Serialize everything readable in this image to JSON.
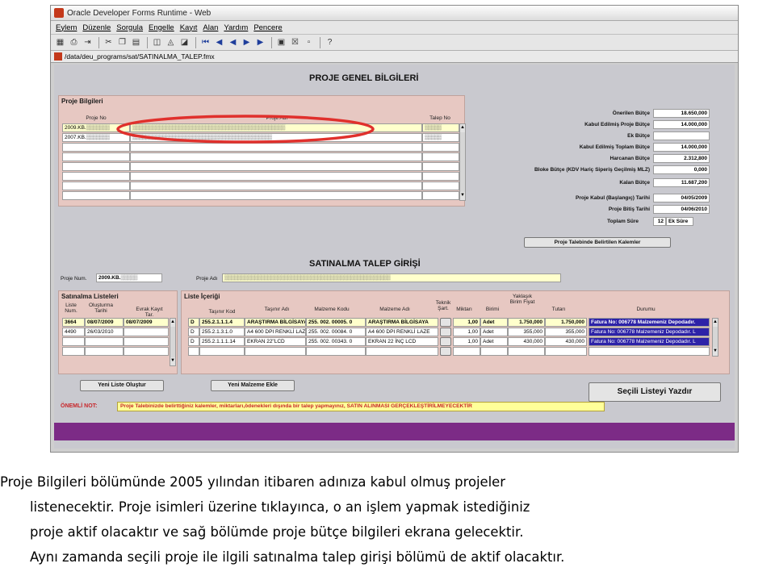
{
  "window": {
    "title": "Oracle Developer Forms Runtime - Web",
    "path": "/data/deu_programs/sat/SATINALMA_TALEP.fmx"
  },
  "menu": [
    "Eylem",
    "Düzenle",
    "Sorgula",
    "Engelle",
    "Kayıt",
    "Alan",
    "Yardım",
    "Pencere"
  ],
  "toolbar_icons": [
    "save-icon",
    "print-icon",
    "exit-icon",
    "cut-icon",
    "copy-icon",
    "paste-icon",
    "query-enter-icon",
    "query-execute-icon",
    "query-cancel-icon",
    "first-record-icon",
    "prev-block-icon",
    "prev-record-icon",
    "next-record-icon",
    "next-block-icon",
    "insert-record-icon",
    "delete-record-icon",
    "lock-record-icon",
    "help-icon"
  ],
  "proje_genel": {
    "title": "PROJE GENEL BİLGİLERİ",
    "panel_title": "Proje Bilgileri",
    "headers": {
      "no": "Proje No",
      "adi": "Proje Adı",
      "talep": "Talep No"
    },
    "rows": [
      {
        "no": "2009.KB.",
        "adi": "",
        "talep": ""
      },
      {
        "no": "2007.KB.",
        "adi": "",
        "talep": ""
      }
    ]
  },
  "butce": [
    {
      "label": "Önerilen Bütçe",
      "value": "18.650,000"
    },
    {
      "label": "Kabul Edilmiş Proje Bütçe",
      "value": "14.000,000"
    },
    {
      "label": "Ek Bütçe",
      "value": ""
    },
    {
      "label": "Kabul Edilmiş Toplam Bütçe",
      "value": "14.000,000"
    },
    {
      "label": "Harcanan Bütçe",
      "value": "2.312,800"
    },
    {
      "label": "Bloke Bütçe (KDV Hariç Siperiş Geçilmiş MLZ)",
      "value": "0,000"
    },
    {
      "label": "Kalan Bütçe",
      "value": "11.687,200"
    },
    {
      "label": "Proje Kabul (Başlangıç) Tarihi",
      "value": "04/05/2009"
    },
    {
      "label": "Proje Bitiş Tarihi",
      "value": "04/06/2010"
    }
  ],
  "toplam_sure": {
    "label": "Toplam Süre",
    "value": "12",
    "ek_label": "Ek Süre"
  },
  "btn_kalemler": "Proje Talebinde Belirtilen Kalemler",
  "satinalma": {
    "title": "SATINALMA TALEP GİRİŞİ",
    "proje_num_label": "Proje Num.",
    "proje_num_value": "2009.KB.",
    "proje_adi_label": "Proje Adı",
    "liste_title": "Satınalma Listeleri",
    "liste_headers": {
      "no": "Liste Num.",
      "olusturma": "Oluşturma Tarihi",
      "evrak": "Evrak Kayıt Tar."
    },
    "liste_rows": [
      {
        "no": "3664",
        "olusturma": "08/07/2009",
        "evrak": "08/07/2009"
      },
      {
        "no": "4490",
        "olusturma": "26/03/2010",
        "evrak": ""
      }
    ],
    "icerik_title": "Liste İçeriği",
    "icerik_headers": {
      "tasinir_kod": "Taşınır Kod",
      "tasinir_adi": "Taşınır Adı",
      "malzeme_kodu": "Malzeme Kodu",
      "malzeme_adi": "Malzeme Adı",
      "teknik": "Teknik Şart.",
      "miktar": "Miktarı",
      "birimi": "Birimi",
      "fiyat": "Yaklaşık Birim Fiyat",
      "tutar": "Tutarı",
      "durum": "Durumu"
    },
    "icerik_rows": [
      {
        "d": "D",
        "kod": "255.2.1.1.1.4",
        "adi": "ARAŞTIRMA BİLGİSAYA",
        "mkod": "255. 002. 00005. 0",
        "madi": "ARAŞTIRMA BİLGİSAYA",
        "miktar": "1,00",
        "birim": "Adet",
        "fiyat": "1.750,000",
        "tutar": "1.750,000",
        "durum": "Fatura No: 006778 Malzemeniz Depodadır."
      },
      {
        "d": "D",
        "kod": "255.2.1.3.1.0",
        "adi": "A4 600 DPI RENKLİ LAZE",
        "mkod": "255. 002. 00084. 0",
        "madi": "A4 600 DPI RENKLİ LAZE",
        "miktar": "1,00",
        "birim": "Adet",
        "fiyat": "355,000",
        "tutar": "355,000",
        "durum": "Fatura No: 006778 Malzemeniz Depodadır. L"
      },
      {
        "d": "D",
        "kod": "255.2.1.1.1.14",
        "adi": "EKRAN 22\"LCD",
        "mkod": "255. 002. 00343. 0",
        "madi": "EKRAN 22 İNÇ LCD",
        "miktar": "1,00",
        "birim": "Adet",
        "fiyat": "430,000",
        "tutar": "430,000",
        "durum": "Fatura No: 006778 Malzemeniz Depodadır. L"
      }
    ],
    "btn_yeni_liste": "Yeni Liste Oluştur",
    "btn_yeni_malzeme": "Yeni Malzeme Ekle",
    "btn_yazdir": "Seçili Listeyi Yazdır"
  },
  "onemli": {
    "label": "ÖNEMLİ NOT:",
    "text": "Proje Talebinizde belirttiğiniz kalemler, miktarları,ödenekleri dışında bir talep yapmayınız, SATIN ALINMASI GERÇEKLEŞTİRİLMEYECEKTİR"
  },
  "caption": [
    "Proje Bilgileri bölümünde 2005 yılından itibaren adınıza kabul olmuş projeler",
    "listenecektir. Proje isimleri üzerine tıklayınca, o an işlem yapmak istediğiniz",
    "proje aktif olacaktır ve sağ bölümde proje bütçe bilgileri ekrana gelecektir.",
    "Aynı zamanda seçili proje ile ilgili satınalma talep girişi bölümü de aktif olacaktır."
  ],
  "colors": {
    "highlight_ellipse": "#e0302c",
    "form_bg": "#c9c9cf",
    "panel_bg": "#e7c8c2",
    "status_bg": "#2d22a8",
    "note_bg": "#ffff99",
    "bottom_bar": "#7c2b86"
  }
}
